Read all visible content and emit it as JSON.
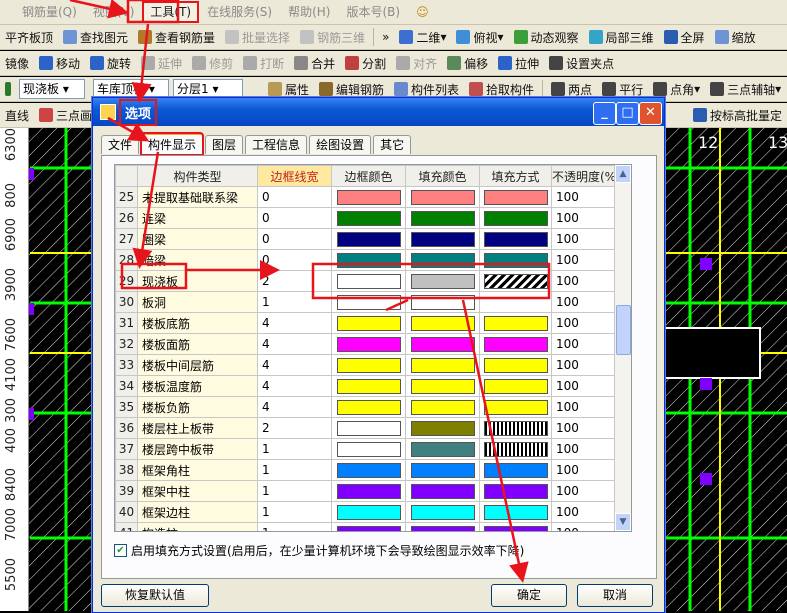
{
  "menubar": {
    "items": [
      {
        "label": "钢筋量(Q)",
        "gray": true
      },
      {
        "label": "视图(V)",
        "gray": true
      },
      {
        "label": "工具(T)",
        "gray": false,
        "highlight": true
      },
      {
        "label": "在线服务(S)",
        "gray": true
      },
      {
        "label": "帮助(H)",
        "gray": true
      },
      {
        "label": "版本号(B)",
        "gray": true
      }
    ]
  },
  "toolbar1": {
    "items": [
      "平齐板顶",
      "查找图元",
      "查看钢筋量",
      "批量选择",
      "钢筋三维"
    ],
    "right": [
      "二维",
      "俯视",
      "动态观察",
      "局部三维",
      "全屏",
      "缩放"
    ]
  },
  "toolbar2": {
    "items": [
      "镜像",
      "移动",
      "旋转",
      "延伸",
      "修剪",
      "打断",
      "合并",
      "分割",
      "对齐",
      "偏移",
      "拉伸",
      "设置夹点"
    ]
  },
  "toolbar3": {
    "select1": "现浇板",
    "select2": "车库顶板",
    "select3": "分层1",
    "items": [
      "属性",
      "编辑钢筋",
      "构件列表",
      "拾取构件",
      "两点",
      "平行",
      "点角",
      "三点辅轴"
    ]
  },
  "toolbar4": {
    "items": [
      "直线",
      "三点画",
      "按标高批量定"
    ]
  },
  "ruler": {
    "labels": [
      "6300",
      "800",
      "6900",
      "3900",
      "7600",
      "4100",
      "300",
      "400",
      "8400",
      "7000",
      "5500"
    ]
  },
  "cad": {
    "grid_labels": [
      "12",
      "13"
    ]
  },
  "dialog": {
    "title": "选项",
    "tabs": [
      "文件",
      "构件显示",
      "图层",
      "工程信息",
      "绘图设置",
      "其它"
    ],
    "active_tab": 1,
    "columns": [
      "构件类型",
      "边框线宽",
      "边框颜色",
      "填充颜色",
      "填充方式",
      "不透明度(%)"
    ],
    "rows": [
      {
        "no": "25",
        "name": "未提取基础联系梁",
        "width": "0",
        "border": "#ff8080",
        "fill": "#ff8080",
        "mode": "#ff8080",
        "opacity": "100"
      },
      {
        "no": "26",
        "name": "连梁",
        "width": "0",
        "border": "#008000",
        "fill": "#008000",
        "mode": "#008000",
        "opacity": "100"
      },
      {
        "no": "27",
        "name": "圈梁",
        "width": "0",
        "border": "#000080",
        "fill": "#000080",
        "mode": "#000080",
        "opacity": "100"
      },
      {
        "no": "28",
        "name": "暗梁",
        "width": "0",
        "border": "#008080",
        "fill": "#008080",
        "mode": "#008080",
        "opacity": "100"
      },
      {
        "no": "29",
        "name": "现浇板",
        "width": "2",
        "border": "#ffffff",
        "fill": "#c0c0c0",
        "mode": "hatch",
        "opacity": "100"
      },
      {
        "no": "30",
        "name": "板洞",
        "width": "1",
        "border": "#ffffff",
        "fill": "#ffffff",
        "mode": "",
        "opacity": "100"
      },
      {
        "no": "31",
        "name": "楼板底筋",
        "width": "4",
        "border": "#ffff00",
        "fill": "#ffff00",
        "mode": "#ffff00",
        "opacity": "100"
      },
      {
        "no": "32",
        "name": "楼板面筋",
        "width": "4",
        "border": "#ff00ff",
        "fill": "#ff00ff",
        "mode": "#ff00ff",
        "opacity": "100"
      },
      {
        "no": "33",
        "name": "楼板中间层筋",
        "width": "4",
        "border": "#ffff00",
        "fill": "#ffff00",
        "mode": "#ffff00",
        "opacity": "100"
      },
      {
        "no": "34",
        "name": "楼板温度筋",
        "width": "4",
        "border": "#ffff00",
        "fill": "#ffff00",
        "mode": "#ffff00",
        "opacity": "100"
      },
      {
        "no": "35",
        "name": "楼板负筋",
        "width": "4",
        "border": "#ffff00",
        "fill": "#ffff00",
        "mode": "#ffff00",
        "opacity": "100"
      },
      {
        "no": "36",
        "name": "楼层柱上板带",
        "width": "2",
        "border": "#ffffff",
        "fill": "#808000",
        "mode": "vbar",
        "opacity": "100"
      },
      {
        "no": "37",
        "name": "楼层跨中板带",
        "width": "1",
        "border": "#ffffff",
        "fill": "#408080",
        "mode": "vbar",
        "opacity": "100"
      },
      {
        "no": "38",
        "name": "框架角柱",
        "width": "1",
        "border": "#0080ff",
        "fill": "#0080ff",
        "mode": "#0080ff",
        "opacity": "100"
      },
      {
        "no": "39",
        "name": "框架中柱",
        "width": "1",
        "border": "#8000ff",
        "fill": "#8000ff",
        "mode": "#8000ff",
        "opacity": "100"
      },
      {
        "no": "40",
        "name": "框架边柱",
        "width": "1",
        "border": "#00ffff",
        "fill": "#00ffff",
        "mode": "#00ffff",
        "opacity": "100"
      },
      {
        "no": "41",
        "name": "构造柱",
        "width": "1",
        "border": "#8000ff",
        "fill": "#8000ff",
        "mode": "#8000ff",
        "opacity": "100"
      }
    ],
    "checkbox_label": "启用填充方式设置(启用后，在少量计算机环境下会导致绘图显示效率下降)",
    "checkbox_checked": true,
    "restore_button": "恢复默认值",
    "ok_button": "确定",
    "cancel_button": "取消"
  },
  "colors": {
    "annotation": "#e8141c",
    "highlight_column": "#ffe9a0",
    "cad_background": "#000000"
  }
}
